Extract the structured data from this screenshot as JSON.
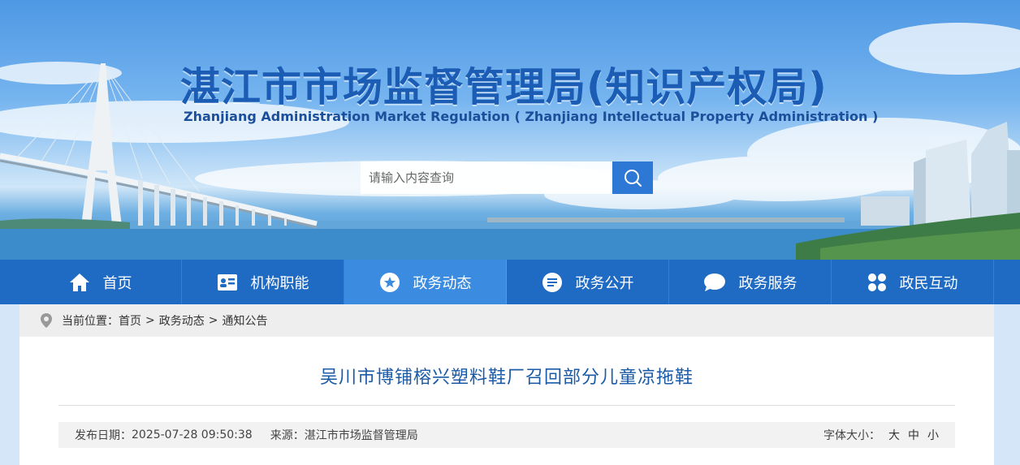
{
  "header": {
    "title": "湛江市市场监督管理局(知识产权局)",
    "subtitle": "Zhanjiang Administration Market Regulation ( Zhanjiang Intellectual Property Administration )",
    "search_placeholder": "请输入内容查询",
    "search_icon": "search-icon"
  },
  "nav": {
    "items": [
      {
        "label": "首页",
        "icon": "home-icon"
      },
      {
        "label": "机构职能",
        "icon": "id-card-icon"
      },
      {
        "label": "政务动态",
        "icon": "star-circle-icon"
      },
      {
        "label": "政务公开",
        "icon": "document-icon"
      },
      {
        "label": "政务服务",
        "icon": "chat-bubble-icon"
      },
      {
        "label": "政民互动",
        "icon": "grid-icon"
      }
    ],
    "active_index": 2
  },
  "breadcrumb": {
    "prefix": "当前位置：",
    "items": [
      "首页",
      "政务动态",
      "通知公告"
    ],
    "separator": ">"
  },
  "article": {
    "title": "吴川市博铺榕兴塑料鞋厂召回部分儿童凉拖鞋",
    "publish_label": "发布日期：",
    "publish_date": "2025-07-28 09:50:38",
    "source_label": "来源：",
    "source": "湛江市市场监督管理局",
    "font_size_label": "字体大小：",
    "font_size_options": [
      "大",
      "中",
      "小"
    ]
  },
  "colors": {
    "nav_bg": "#1f6bc4",
    "nav_active": "#3b8ce0",
    "title_blue": "#1b5cb4",
    "article_title": "#1a5aa6"
  }
}
